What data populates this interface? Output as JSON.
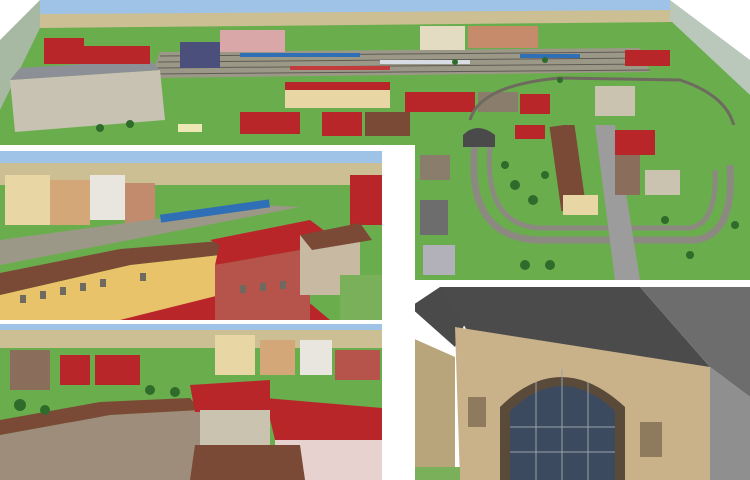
{
  "composite": {
    "panels": [
      {
        "id": "overview",
        "scene": "model-railway-layout-overview"
      },
      {
        "id": "street-view-1",
        "scene": "city-blocks-with-red-roofs"
      },
      {
        "id": "track-loop",
        "scene": "track-loop-with-tunnel"
      },
      {
        "id": "street-view-2",
        "scene": "city-blocks-with-tunnel-portal"
      },
      {
        "id": "station-facade",
        "scene": "railway-station-arched-facade"
      }
    ]
  },
  "colors": {
    "sky": "#9fc3e6",
    "grass": "#5aa844",
    "roof_red": "#b8262a",
    "roof_brown": "#7a4a36",
    "facade_cream": "#e8d7a4",
    "station_stone": "#c9b18a",
    "track": "#8c8a80"
  }
}
